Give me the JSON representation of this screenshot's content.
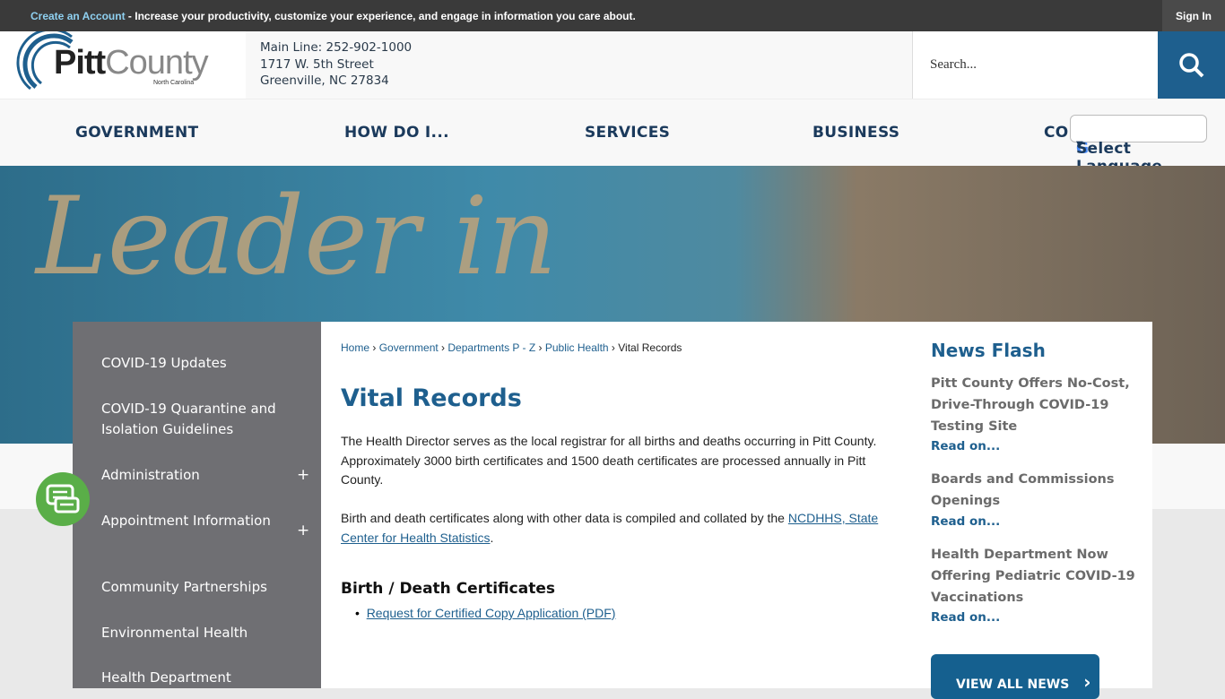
{
  "topbar": {
    "create_account": "Create an Account",
    "tagline": " - Increase your productivity, customize your experience, and engage in information you care about.",
    "sign_in": "Sign In"
  },
  "logo": {
    "text_pitt": "Pitt",
    "text_county": "County",
    "subtitle": "North Carolina"
  },
  "contact": {
    "main_line": "Main Line: 252-902-1000",
    "street": "1717 W. 5th Street",
    "city": "Greenville, NC 27834"
  },
  "search": {
    "placeholder": "Search..."
  },
  "nav": [
    "GOVERNMENT",
    "HOW DO I...",
    "SERVICES",
    "BUSINESS",
    "CO"
  ],
  "language": {
    "label": "Select Language"
  },
  "hero": {
    "text": "Leader in"
  },
  "sidebar": [
    {
      "label": "COVID-19 Updates"
    },
    {
      "label": "COVID-19 Quarantine and Isolation Guidelines"
    },
    {
      "label": "Administration",
      "expand": "+"
    },
    {
      "label": "Appointment Information",
      "expand": "+"
    },
    {
      "label": "Community Partnerships"
    },
    {
      "label": "Environmental Health"
    },
    {
      "label": "Health Department"
    }
  ],
  "breadcrumb": [
    "Home",
    "Government",
    "Departments P - Z",
    "Public Health",
    "Vital Records"
  ],
  "page": {
    "title": "Vital Records",
    "p1": "The Health Director serves as the local registrar for all births and deaths occurring in Pitt County. Approximately 3000 birth certificates and 1500 death certificates are processed annually in Pitt County.",
    "p2_prefix": "Birth and death certificates along with other data is compiled and collated by the ",
    "p2_link": "NCDHHS, State Center for Health Statistics",
    "p2_suffix": ".",
    "section": "Birth / Death Certificates",
    "link": "Request for Certified Copy Application (PDF)"
  },
  "news": {
    "title": "News Flash",
    "items": [
      {
        "title": "Pitt County Offers No-Cost, Drive-Through COVID-19 Testing Site",
        "read": "Read on..."
      },
      {
        "title": "Boards and Commissions Openings",
        "read": "Read on..."
      },
      {
        "title": "Health Department Now Offering Pediatric COVID-19 Vaccinations",
        "read": "Read on..."
      }
    ],
    "view_all": "VIEW ALL NEWS"
  },
  "colors": {
    "brand": "#1e5f8e",
    "sidebar": "#6f6f73",
    "chat": "#5aae48"
  }
}
